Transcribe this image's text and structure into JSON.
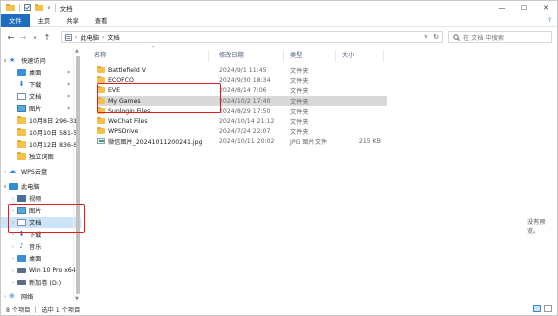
{
  "window": {
    "title": "文档",
    "caption": {
      "minimize": "—",
      "maximize": "☐",
      "close": "✕"
    }
  },
  "ribbon": {
    "tabs": [
      "文件",
      "主页",
      "共享",
      "查看"
    ],
    "help": "?"
  },
  "address": {
    "crumbs": [
      "此电脑",
      "文档"
    ],
    "search_placeholder": "在 文档 中搜索"
  },
  "sidebar": {
    "items": [
      {
        "label": "快速访问",
        "icon": "star-icon"
      },
      {
        "label": "桌面",
        "icon": "desktop-icon"
      },
      {
        "label": "下载",
        "icon": "download-icon"
      },
      {
        "label": "文档",
        "icon": "documents-icon"
      },
      {
        "label": "图片",
        "icon": "pictures-icon"
      },
      {
        "label": "10月8日 296-31",
        "icon": "folder-icon"
      },
      {
        "label": "10月10日 581-5",
        "icon": "folder-icon"
      },
      {
        "label": "10月12日 836-6",
        "icon": "folder-icon"
      },
      {
        "label": "独立词图",
        "icon": "folder-icon"
      },
      {
        "label": "WPS云盘",
        "icon": "cloud-icon"
      },
      {
        "label": "此电脑",
        "icon": "computer-icon"
      },
      {
        "label": "视频",
        "icon": "videos-icon"
      },
      {
        "label": "图片",
        "icon": "pictures-icon"
      },
      {
        "label": "文档",
        "icon": "documents-icon"
      },
      {
        "label": "下载",
        "icon": "download-icon"
      },
      {
        "label": "音乐",
        "icon": "music-icon"
      },
      {
        "label": "桌面",
        "icon": "desktop-icon"
      },
      {
        "label": "Win 10 Pro x64",
        "icon": "drive-icon"
      },
      {
        "label": "新加卷 (D:)",
        "icon": "drive-icon"
      },
      {
        "label": "网络",
        "icon": "network-icon"
      }
    ]
  },
  "columns": {
    "name": "名称",
    "date": "修改日期",
    "type": "类型",
    "size": "大小"
  },
  "files": [
    {
      "name": "Battlefield V",
      "date": "2024/9/1 11:45",
      "type": "文件夹",
      "size": "",
      "icon": "folder-icon"
    },
    {
      "name": "ECOFCO",
      "date": "2024/9/30 18:34",
      "type": "文件夹",
      "size": "",
      "icon": "folder-icon"
    },
    {
      "name": "EVE",
      "date": "2024/8/14 7:06",
      "type": "文件夹",
      "size": "",
      "icon": "folder-icon"
    },
    {
      "name": "My Games",
      "date": "2024/10/2 17:40",
      "type": "文件夹",
      "size": "",
      "icon": "folder-icon"
    },
    {
      "name": "Sunlogin Files",
      "date": "2024/8/29 17:50",
      "type": "文件夹",
      "size": "",
      "icon": "folder-icon"
    },
    {
      "name": "WeChat Files",
      "date": "2024/10/14 21:12",
      "type": "文件夹",
      "size": "",
      "icon": "folder-icon"
    },
    {
      "name": "WPSDrive",
      "date": "2024/7/24 22:07",
      "type": "文件夹",
      "size": "",
      "icon": "folder-icon"
    },
    {
      "name": "微信图片_20241011200241.jpg",
      "date": "2024/10/11 20:02",
      "type": "JPG 图片文件",
      "size": "215 KB",
      "icon": "image-file-icon"
    }
  ],
  "preview": {
    "empty": "没有预览。"
  },
  "status": {
    "count": "8 个项目",
    "selected": "选中 1 个项目"
  }
}
